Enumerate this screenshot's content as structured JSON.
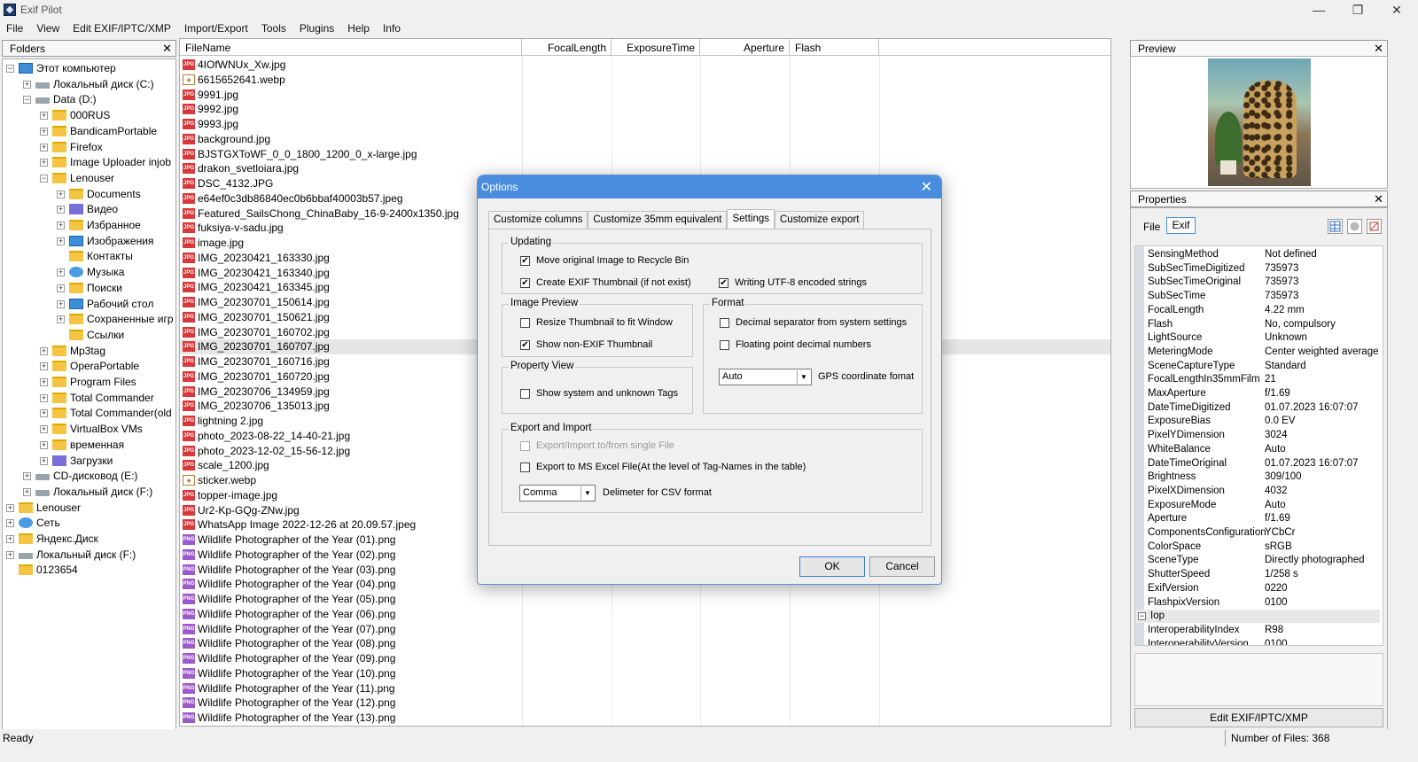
{
  "window": {
    "title": "Exif Pilot",
    "min": "—",
    "max": "❐",
    "close": "✕"
  },
  "menu": [
    "File",
    "View",
    "Edit EXIF/IPTC/XMP",
    "Import/Export",
    "Tools",
    "Plugins",
    "Help",
    "Info"
  ],
  "folders": {
    "header": "Folders",
    "close": "✕",
    "items": [
      {
        "label": "Этот компьютер",
        "level": 0,
        "icon": "pc",
        "exp": "−"
      },
      {
        "label": "Локальный диск (C:)",
        "level": 1,
        "icon": "drive",
        "exp": "+"
      },
      {
        "label": "Data (D:)",
        "level": 1,
        "icon": "drive",
        "exp": "−"
      },
      {
        "label": "000RUS",
        "level": 2,
        "icon": "folder",
        "exp": "+"
      },
      {
        "label": "BandicamPortable",
        "level": 2,
        "icon": "folder",
        "exp": "+"
      },
      {
        "label": "Firefox",
        "level": 2,
        "icon": "folder",
        "exp": "+"
      },
      {
        "label": "Image Uploader injob",
        "level": 2,
        "icon": "folder",
        "exp": "+"
      },
      {
        "label": "Lenouser",
        "level": 2,
        "icon": "folder",
        "exp": "−"
      },
      {
        "label": "Documents",
        "level": 3,
        "icon": "folder",
        "exp": "+"
      },
      {
        "label": "Видео",
        "level": 3,
        "icon": "special",
        "exp": "+"
      },
      {
        "label": "Избранное",
        "level": 3,
        "icon": "folder",
        "exp": "+"
      },
      {
        "label": "Изображения",
        "level": 3,
        "icon": "pc",
        "exp": "+"
      },
      {
        "label": "Контакты",
        "level": 3,
        "icon": "folder",
        "exp": ""
      },
      {
        "label": "Музыка",
        "level": 3,
        "icon": "net",
        "exp": "+"
      },
      {
        "label": "Поиски",
        "level": 3,
        "icon": "folder",
        "exp": "+"
      },
      {
        "label": "Рабочий стол",
        "level": 3,
        "icon": "pc",
        "exp": "+"
      },
      {
        "label": "Сохраненные игр",
        "level": 3,
        "icon": "folder",
        "exp": "+"
      },
      {
        "label": "Ссылки",
        "level": 3,
        "icon": "folder",
        "exp": ""
      },
      {
        "label": "Mp3tag",
        "level": 2,
        "icon": "folder",
        "exp": "+"
      },
      {
        "label": "OperaPortable",
        "level": 2,
        "icon": "folder",
        "exp": "+"
      },
      {
        "label": "Program Files",
        "level": 2,
        "icon": "folder",
        "exp": "+"
      },
      {
        "label": "Total Commander",
        "level": 2,
        "icon": "folder",
        "exp": "+"
      },
      {
        "label": "Total Commander(old",
        "level": 2,
        "icon": "folder",
        "exp": "+"
      },
      {
        "label": "VirtualBox VMs",
        "level": 2,
        "icon": "folder",
        "exp": "+"
      },
      {
        "label": "временная",
        "level": 2,
        "icon": "folder",
        "exp": "+"
      },
      {
        "label": "Загрузки",
        "level": 2,
        "icon": "special",
        "exp": "+"
      },
      {
        "label": "CD-дисковод (E:)",
        "level": 1,
        "icon": "drive",
        "exp": "+"
      },
      {
        "label": "Локальный диск (F:)",
        "level": 1,
        "icon": "drive",
        "exp": "+"
      },
      {
        "label": "Lenouser",
        "level": 0,
        "icon": "folder",
        "exp": "+"
      },
      {
        "label": "Сеть",
        "level": 0,
        "icon": "net",
        "exp": "+"
      },
      {
        "label": "Яндекс.Диск",
        "level": 0,
        "icon": "folder",
        "exp": "+"
      },
      {
        "label": "Локальный диск (F:)",
        "level": 0,
        "icon": "drive",
        "exp": "+"
      },
      {
        "label": "0123654",
        "level": 0,
        "icon": "folder",
        "exp": ""
      }
    ]
  },
  "filelist": {
    "columns": [
      "FileName",
      "FocalLength",
      "ExposureTime",
      "Aperture",
      "Flash"
    ],
    "files": [
      {
        "name": "4IOfWNUx_Xw.jpg",
        "type": "jpg"
      },
      {
        "name": "6615652641.webp",
        "type": "webp"
      },
      {
        "name": "9991.jpg",
        "type": "jpg"
      },
      {
        "name": "9992.jpg",
        "type": "jpg"
      },
      {
        "name": "9993.jpg",
        "type": "jpg"
      },
      {
        "name": "background.jpg",
        "type": "jpg"
      },
      {
        "name": "BJSTGXToWF_0_0_1800_1200_0_x-large.jpg",
        "type": "jpg"
      },
      {
        "name": "drakon_svetloiara.jpg",
        "type": "jpg"
      },
      {
        "name": "DSC_4132.JPG",
        "type": "jpg"
      },
      {
        "name": "e64ef0c3db86840ec0b6bbaf40003b57.jpeg",
        "type": "jpg"
      },
      {
        "name": "Featured_SailsChong_ChinaBaby_16-9-2400x1350.jpg",
        "type": "jpg"
      },
      {
        "name": "fuksiya-v-sadu.jpg",
        "type": "jpg"
      },
      {
        "name": "image.jpg",
        "type": "jpg"
      },
      {
        "name": "IMG_20230421_163330.jpg",
        "type": "jpg"
      },
      {
        "name": "IMG_20230421_163340.jpg",
        "type": "jpg"
      },
      {
        "name": "IMG_20230421_163345.jpg",
        "type": "jpg"
      },
      {
        "name": "IMG_20230701_150614.jpg",
        "type": "jpg"
      },
      {
        "name": "IMG_20230701_150621.jpg",
        "type": "jpg"
      },
      {
        "name": "IMG_20230701_160702.jpg",
        "type": "jpg"
      },
      {
        "name": "IMG_20230701_160707.jpg",
        "type": "jpg"
      },
      {
        "name": "IMG_20230701_160716.jpg",
        "type": "jpg"
      },
      {
        "name": "IMG_20230701_160720.jpg",
        "type": "jpg"
      },
      {
        "name": "IMG_20230706_134959.jpg",
        "type": "jpg"
      },
      {
        "name": "IMG_20230706_135013.jpg",
        "type": "jpg"
      },
      {
        "name": "lightning 2.jpg",
        "type": "jpg"
      },
      {
        "name": "photo_2023-08-22_14-40-21.jpg",
        "type": "jpg"
      },
      {
        "name": "photo_2023-12-02_15-56-12.jpg",
        "type": "jpg"
      },
      {
        "name": "scale_1200.jpg",
        "type": "jpg"
      },
      {
        "name": "sticker.webp",
        "type": "webp"
      },
      {
        "name": "topper-image.jpg",
        "type": "jpg"
      },
      {
        "name": "Ur2-Kp-GQg-ZNw.jpg",
        "type": "jpg"
      },
      {
        "name": "WhatsApp Image 2022-12-26 at 20.09.57.jpeg",
        "type": "jpg"
      },
      {
        "name": "Wildlife Photographer of the Year (01).png",
        "type": "png"
      },
      {
        "name": "Wildlife Photographer of the Year (02).png",
        "type": "png"
      },
      {
        "name": "Wildlife Photographer of the Year (03).png",
        "type": "png"
      },
      {
        "name": "Wildlife Photographer of the Year (04).png",
        "type": "png"
      },
      {
        "name": "Wildlife Photographer of the Year (05).png",
        "type": "png"
      },
      {
        "name": "Wildlife Photographer of the Year (06).png",
        "type": "png"
      },
      {
        "name": "Wildlife Photographer of the Year (07).png",
        "type": "png"
      },
      {
        "name": "Wildlife Photographer of the Year (08).png",
        "type": "png"
      },
      {
        "name": "Wildlife Photographer of the Year (09).png",
        "type": "png"
      },
      {
        "name": "Wildlife Photographer of the Year (10).png",
        "type": "png"
      },
      {
        "name": "Wildlife Photographer of the Year (11).png",
        "type": "png"
      },
      {
        "name": "Wildlife Photographer of the Year (12).png",
        "type": "png"
      },
      {
        "name": "Wildlife Photographer of the Year (13).png",
        "type": "png"
      }
    ],
    "selected_index": 19
  },
  "preview": {
    "header": "Preview",
    "close": "✕"
  },
  "properties": {
    "header": "Properties",
    "close": "✕",
    "file_label": "File",
    "tab": "Exif",
    "rows": [
      [
        "SensingMethod",
        "Not defined"
      ],
      [
        "SubSecTimeDigitized",
        "735973"
      ],
      [
        "SubSecTimeOriginal",
        "735973"
      ],
      [
        "SubSecTime",
        "735973"
      ],
      [
        "FocalLength",
        "4.22 mm"
      ],
      [
        "Flash",
        "No, compulsory"
      ],
      [
        "LightSource",
        "Unknown"
      ],
      [
        "MeteringMode",
        "Center weighted average"
      ],
      [
        "SceneCaptureType",
        "Standard"
      ],
      [
        "FocalLengthIn35mmFilm",
        "21"
      ],
      [
        "MaxAperture",
        "f/1.69"
      ],
      [
        "DateTimeDigitized",
        "01.07.2023 16:07:07"
      ],
      [
        "ExposureBias",
        "0.0 EV"
      ],
      [
        "PixelYDimension",
        "3024"
      ],
      [
        "WhiteBalance",
        "Auto"
      ],
      [
        "DateTimeOriginal",
        "01.07.2023 16:07:07"
      ],
      [
        "Brightness",
        "309/100"
      ],
      [
        "PixelXDimension",
        "4032"
      ],
      [
        "ExposureMode",
        "Auto"
      ],
      [
        "Aperture",
        "f/1.69"
      ],
      [
        "ComponentsConfiguration",
        "YCbCr"
      ],
      [
        "ColorSpace",
        "sRGB"
      ],
      [
        "SceneType",
        "Directly photographed"
      ],
      [
        "ShutterSpeed",
        "1/258 s"
      ],
      [
        "ExifVersion",
        "0220"
      ],
      [
        "FlashpixVersion",
        "0100"
      ]
    ],
    "group": {
      "name": "Iop",
      "exp": "−"
    },
    "group_rows": [
      [
        "InteroperabilityIndex",
        "R98"
      ],
      [
        "InteroperabilityVersion",
        "0100"
      ]
    ],
    "edit_button": "Edit EXIF/IPTC/XMP"
  },
  "status": {
    "left": "Ready",
    "right": "Number of Files: 368"
  },
  "dialog": {
    "title": "Options",
    "close": "✕",
    "tabs": [
      "Customize columns",
      "Customize 35mm equivalent",
      "Settings",
      "Customize export"
    ],
    "active_tab": 2,
    "updating": {
      "title": "Updating",
      "move_recycle": "Move original Image to Recycle Bin",
      "create_thumb": "Create EXIF Thumbnail (if not exist)",
      "utf8": "Writing UTF-8 encoded strings"
    },
    "image_preview": {
      "title": "Image Preview",
      "resize": "Resize Thumbnail to fit Window",
      "show_non_exif": "Show non-EXIF Thumbnail"
    },
    "format": {
      "title": "Format",
      "decimal_sep": "Decimal separator from system settings",
      "floating": "Floating point decimal numbers",
      "gps_value": "Auto",
      "gps_label": "GPS coordinate fomat"
    },
    "property_view": {
      "title": "Property View",
      "show_system": "Show system and unknown Tags"
    },
    "export_import": {
      "title": "Export and Import",
      "single_file": "Export/Import  to/from single File",
      "excel": "Export to MS Excel File(At the level of Tag-Names in the table)",
      "delim_value": "Comma",
      "delim_label": "Delimeter for CSV format"
    },
    "check": "✔",
    "ok": "OK",
    "cancel": "Cancel"
  }
}
